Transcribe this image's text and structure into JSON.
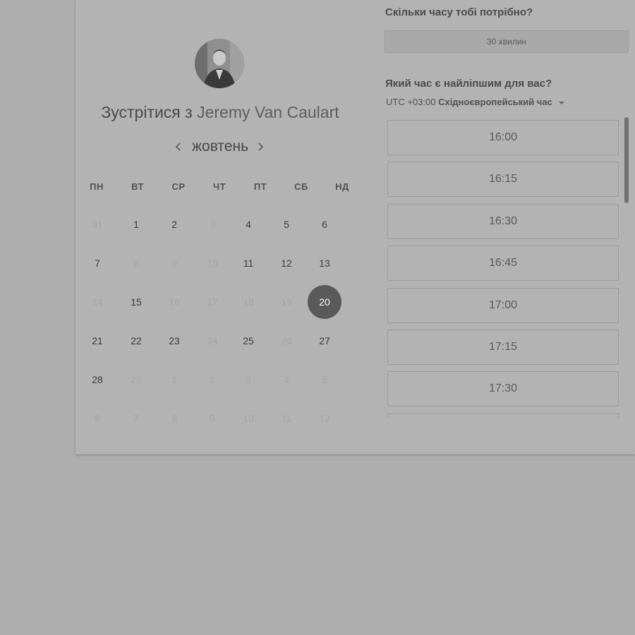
{
  "host": {
    "title_prefix": "Зустрітися з",
    "name": "Jeremy Van Caulart"
  },
  "calendar": {
    "month": "жовтень",
    "weekdays": [
      "ПН",
      "ВТ",
      "СР",
      "ЧТ",
      "ПТ",
      "СБ",
      "НД"
    ],
    "weeks": [
      [
        {
          "d": "31",
          "muted": true
        },
        {
          "d": "1"
        },
        {
          "d": "2"
        },
        {
          "d": "3",
          "muted": true
        },
        {
          "d": "4"
        },
        {
          "d": "5"
        },
        {
          "d": "6"
        }
      ],
      [
        {
          "d": "7"
        },
        {
          "d": "8",
          "muted": true
        },
        {
          "d": "9",
          "muted": true
        },
        {
          "d": "10",
          "muted": true
        },
        {
          "d": "11"
        },
        {
          "d": "12"
        },
        {
          "d": "13"
        }
      ],
      [
        {
          "d": "14",
          "muted": true
        },
        {
          "d": "15"
        },
        {
          "d": "16",
          "muted": true
        },
        {
          "d": "17",
          "muted": true
        },
        {
          "d": "18",
          "muted": true
        },
        {
          "d": "19",
          "muted": true
        },
        {
          "d": "20",
          "selected": true
        }
      ],
      [
        {
          "d": "21"
        },
        {
          "d": "22"
        },
        {
          "d": "23"
        },
        {
          "d": "24",
          "muted": true
        },
        {
          "d": "25"
        },
        {
          "d": "26",
          "muted": true
        },
        {
          "d": "27"
        }
      ],
      [
        {
          "d": "28"
        },
        {
          "d": "29",
          "muted": true
        },
        {
          "d": "1",
          "muted": true
        },
        {
          "d": "2",
          "muted": true
        },
        {
          "d": "3",
          "muted": true
        },
        {
          "d": "4",
          "muted": true
        },
        {
          "d": "5",
          "muted": true
        }
      ],
      [
        {
          "d": "6",
          "muted": true
        },
        {
          "d": "7",
          "muted": true
        },
        {
          "d": "8",
          "muted": true
        },
        {
          "d": "9",
          "muted": true
        },
        {
          "d": "10",
          "muted": true
        },
        {
          "d": "11",
          "muted": true
        },
        {
          "d": "12",
          "muted": true
        }
      ]
    ]
  },
  "duration": {
    "question": "Скільки часу тобі потрібно?",
    "value": "30 хвилин"
  },
  "time": {
    "question": "Який час є найліпшим для вас?",
    "tz_offset": "UTC +03:00",
    "tz_name": "Східноєвропейський час",
    "slots": [
      "16:00",
      "16:15",
      "16:30",
      "16:45",
      "17:00",
      "17:15",
      "17:30",
      ""
    ]
  },
  "colors": {
    "overlay_background": "#adadad",
    "selected_day": "#5a5a5a"
  }
}
